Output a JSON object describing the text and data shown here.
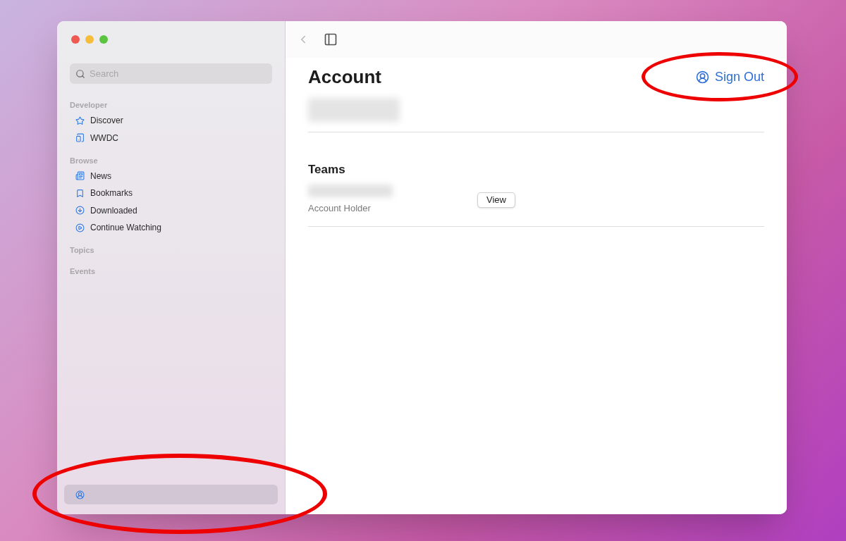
{
  "sidebar": {
    "search": {
      "placeholder": "Search"
    },
    "sections": [
      {
        "title": "Developer",
        "items": [
          {
            "label": "Discover",
            "selected": false
          },
          {
            "label": "WWDC",
            "selected": false
          }
        ]
      },
      {
        "title": "Browse",
        "items": [
          {
            "label": "News",
            "selected": false
          },
          {
            "label": "Bookmarks",
            "selected": false
          },
          {
            "label": "Downloaded",
            "selected": false
          },
          {
            "label": "Continue Watching",
            "selected": false
          }
        ]
      },
      {
        "title": "Topics"
      },
      {
        "title": "Events"
      }
    ],
    "account_item": {
      "selected": true
    }
  },
  "main": {
    "title": "Account",
    "sign_out": "Sign Out",
    "teams": {
      "title": "Teams",
      "role": "Account Holder",
      "button": "View"
    }
  }
}
